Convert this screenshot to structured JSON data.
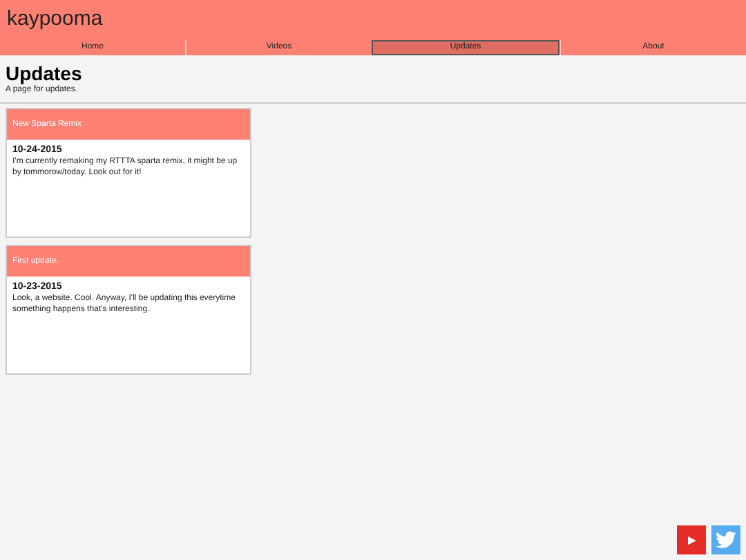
{
  "site_title": "kaypooma",
  "nav": [
    {
      "label": "Home",
      "selected": false
    },
    {
      "label": "Videos",
      "selected": false
    },
    {
      "label": "Updates",
      "selected": true
    },
    {
      "label": "About",
      "selected": false
    }
  ],
  "page": {
    "heading": "Updates",
    "subtitle": "A page for updates."
  },
  "posts": [
    {
      "title": "New Sparta Remix",
      "date": "10-24-2015",
      "body": "I'm currently remaking my RTTTA sparta remix, it might be up by tommorow/today. Look out for it!"
    },
    {
      "title": "First update.",
      "date": "10-23-2015",
      "body": "Look, a website. Cool. Anyway, I'll be updating this everytime something happens that's interesting."
    }
  ],
  "social": [
    {
      "kind": "youtube"
    },
    {
      "kind": "twitter"
    }
  ]
}
